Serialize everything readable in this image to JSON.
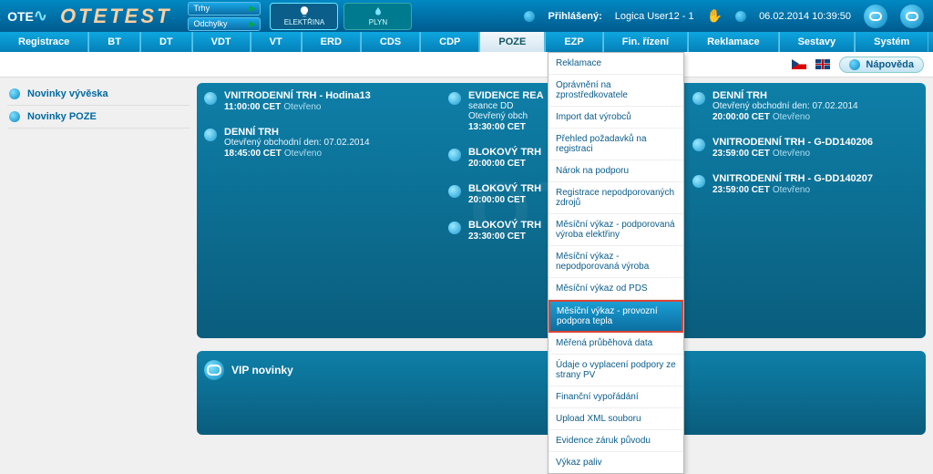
{
  "top": {
    "logo": "OTE",
    "brand": "OTETEST",
    "mini1": "Trhy",
    "mini2": "Odchylky",
    "tab_elek": "ELEKTŘINA",
    "tab_plyn": "PLYN",
    "logged_label": "Přihlášený:",
    "user": "Logica User12 - 1",
    "datetime": "06.02.2014 10:39:50"
  },
  "nav": {
    "items": [
      "Registrace",
      "BT",
      "DT",
      "VDT",
      "VT",
      "ERD",
      "CDS",
      "CDP",
      "POZE",
      "EZP",
      "Fin. řízení",
      "Reklamace",
      "Sestavy",
      "Systém"
    ],
    "active_index": 8
  },
  "help_label": "Nápověda",
  "side": {
    "link1": "Novinky vývěska",
    "link2": "Novinky POZE"
  },
  "watermark": "OTE",
  "cols": {
    "c0": [
      {
        "title": "VNITRODENNÍ TRH - Hodina13",
        "sub": "",
        "time": "11:00:00 CET",
        "stat": "Otevřeno"
      },
      {
        "title": "DENNÍ TRH",
        "sub": "Otevřený obchodní den: 07.02.2014",
        "time": "18:45:00 CET",
        "stat": "Otevřeno"
      }
    ],
    "c1": [
      {
        "title": "EVIDENCE REA",
        "sub": "seance DD",
        "sub2": "Otevřený obch",
        "time": "13:30:00 CET",
        "stat": ""
      },
      {
        "title": "BLOKOVÝ TRH",
        "sub": "",
        "time": "20:00:00 CET",
        "stat": ""
      },
      {
        "title": "BLOKOVÝ TRH",
        "sub": "",
        "time": "20:00:00 CET",
        "stat": ""
      },
      {
        "title": "BLOKOVÝ TRH",
        "sub": "",
        "time": "23:30:00 CET",
        "stat": ""
      }
    ],
    "c2": [
      {
        "title": "DENNÍ TRH",
        "sub": "Otevřený obchodní den: 07.02.2014",
        "time": "20:00:00 CET",
        "stat": "Otevřeno"
      },
      {
        "title": "VNITRODENNÍ TRH - G-DD140206",
        "sub": "",
        "time": "23:59:00 CET",
        "stat": "Otevřeno"
      },
      {
        "title": "VNITRODENNÍ TRH - G-DD140207",
        "sub": "",
        "time": "23:59:00 CET",
        "stat": "Otevřeno"
      }
    ]
  },
  "vip": "VIP novinky",
  "menu": {
    "items": [
      "Reklamace",
      "Oprávnění na zprostředkovatele",
      "Import dat výrobců",
      "Přehled požadavků na registraci",
      "Nárok na podporu",
      "Registrace nepodporovaných zdrojů",
      "Měsíční výkaz - podporovaná výroba elektřiny",
      "Měsíční výkaz - nepodporovaná výroba",
      "Měsíční výkaz od PDS",
      "Měsíční výkaz - provozní podpora tepla",
      "Měřená průběhová data",
      "Údaje o vyplacení podpory ze strany PV",
      "Finanční vypořádání",
      "Upload XML souboru",
      "Evidence záruk původu",
      "Výkaz paliv"
    ],
    "highlight_index": 9
  }
}
